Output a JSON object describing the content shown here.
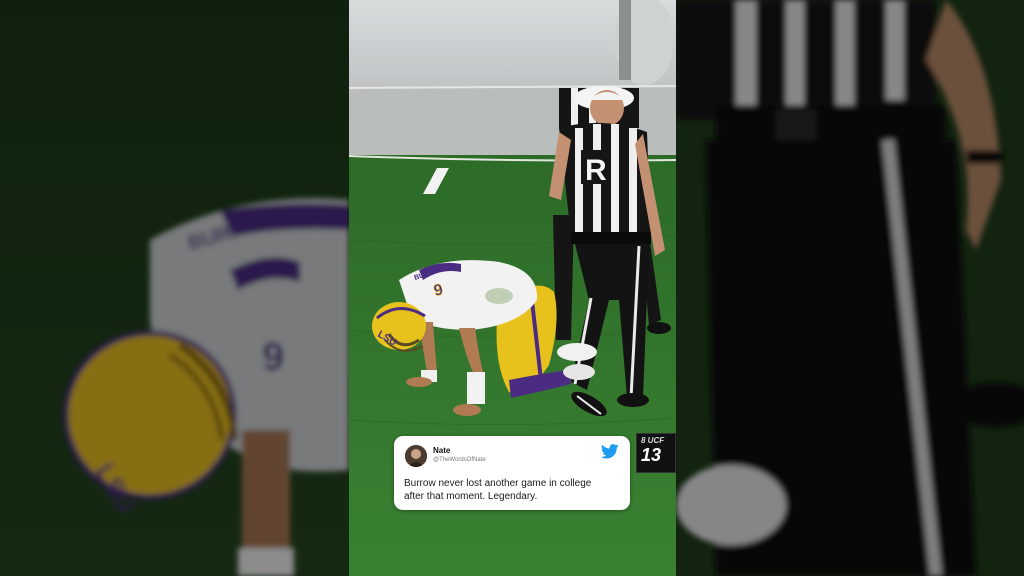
{
  "tweet": {
    "name": "Nate",
    "handle": "@TheWordsOfNate",
    "text_line1": "Burrow never lost another game in college",
    "text_line2": "after that moment. Legendary."
  },
  "scorebug": {
    "team": "8 UCF",
    "score": "13"
  },
  "scene": {
    "jersey_number": "9",
    "helmet_text": "LSU",
    "jersey_nameplate": "BURROW",
    "referee_letter": "R"
  },
  "colors": {
    "field_green": "#2f6e2a",
    "lsu_gold": "#e8c21c",
    "lsu_purple": "#4b2c83",
    "twitter_blue": "#1d9bf0"
  }
}
